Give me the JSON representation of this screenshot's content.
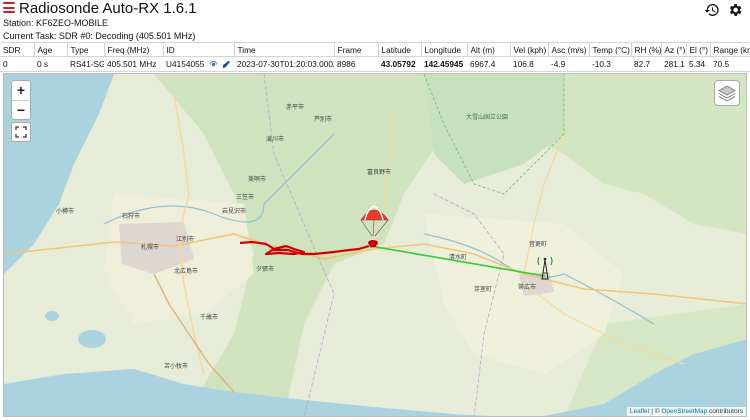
{
  "header": {
    "app_title": "Radiosonde Auto-RX 1.6.1",
    "station": "Station: KF6ZEO-MOBILE",
    "current_task": "Current Task: SDR #0: Decoding (405.501 MHz)"
  },
  "table": {
    "columns": [
      "SDR",
      "Age",
      "Type",
      "Freq (MHz)",
      "ID",
      "Time",
      "Frame",
      "Latitude",
      "Longitude",
      "Alt (m)",
      "Vel (kph)",
      "Asc (m/s)",
      "Temp (°C)",
      "RH (%)",
      "Az (°)",
      "El (°)",
      "Range (km)"
    ],
    "rows": [
      {
        "sdr": "0",
        "age": "0 s",
        "type": "RS41-SG",
        "freq": "405.501 MHz",
        "id": "U4154055",
        "time": "2023-07-30T01:20:03.000Z",
        "frame": "8986",
        "latitude": "43.05792",
        "longitude": "142.45945",
        "alt": "6967.4",
        "vel": "106.8",
        "asc": "-4.9",
        "temp": "-10.3",
        "rh": "82.7",
        "az": "281.1",
        "el": "5.34",
        "range": "70.5"
      }
    ]
  },
  "map": {
    "zoom_in": "+",
    "zoom_out": "−",
    "attribution_leaflet": "Leaflet",
    "attribution_sep": " | © ",
    "attribution_osm": "OpenStreetMap",
    "attribution_suffix": " contributors",
    "track_color": "#d40000",
    "los_color": "#33cc33",
    "labels": {
      "ishikari": "石狩市",
      "sapporo": "札幌市",
      "ebetsu": "江別市",
      "kitahiroshima": "北広島市",
      "chitose": "千歳市",
      "tomakomai": "苫小牧市",
      "iwamizawa": "岩見沢市",
      "bibai": "美唄市",
      "takikawa": "滝川市",
      "obihiro": "帯広市",
      "furano": "富良野市",
      "otaru": "小樽市",
      "daisetsuzan": "大雪山国立公園",
      "shimizu": "清水町",
      "memuro": "芽室町",
      "mikasa": "三笠市",
      "yubari": "夕張市",
      "otofuke": "音更町",
      "ashibetsu": "芦別市",
      "akabira": "赤平市"
    }
  }
}
